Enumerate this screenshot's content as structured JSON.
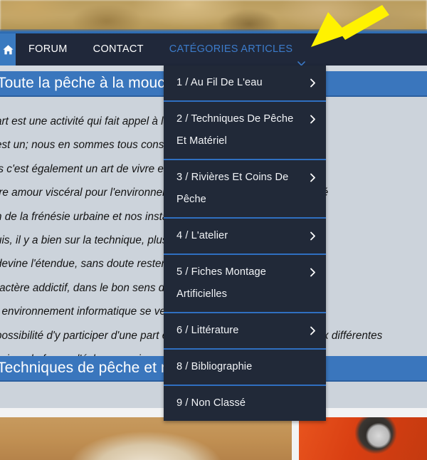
{
  "site": {
    "hero_alt": "blurred golden field photo banner"
  },
  "navbar": {
    "home_icon": "home-icon",
    "items": [
      {
        "label": "FORUM",
        "accent": false
      },
      {
        "label": "CONTACT",
        "accent": false
      },
      {
        "label": "CATÉGORIES ARTICLES",
        "accent": true,
        "icon": "chevron-down-icon"
      }
    ]
  },
  "annotation": {
    "type": "arrow",
    "color": "#FFF200",
    "points_to": "CATÉGORIES ARTICLES"
  },
  "dropdown": {
    "open": true,
    "parent": "CATÉGORIES ARTICLES",
    "items": [
      {
        "label": "1 / Au Fil De L'eau",
        "has_submenu": true
      },
      {
        "label": "2 / Techniques De Pêche Et Matériel",
        "has_submenu": true
      },
      {
        "label": "3 / Rivières Et Coins De Pêche",
        "has_submenu": true
      },
      {
        "label": "4 / L'atelier",
        "has_submenu": true
      },
      {
        "label": "5 / Fiches Montage Artificielles",
        "has_submenu": true
      },
      {
        "label": "6 / Littérature",
        "has_submenu": true
      },
      {
        "label": "8 / Bibliographie",
        "has_submenu": false
      },
      {
        "label": "9 / Non Classé",
        "has_submenu": false
      }
    ]
  },
  "content": {
    "heading_1": "Toute la pêche à la mouche",
    "heading_2": "Techniques de pêche et matériel",
    "paragraph_lines": [
      "art est une activité qui fait appel à la créativité et à l'imagination",
      "est un; nous en sommes tous conscients",
      "is c'est également un art de vivre et de cultiver des valeurs qui",
      "tre amour viscéral pour l'environnement, de partage et de convivialité",
      "n de la frénésie urbaine et nos instants contemplatifs, au rythme",
      "uis, il y a bien sur la technique, plus on pratique plus on apprend",
      "devine l'étendue, sans doute restera-t-il encore inconnu, et c'est",
      "ractère addictif, dans le bon sens du terme",
      "t environnement informatique se veut le reflet de ces différentes",
      "possibilité d'y participer d'une part en apportant vos contributions aux différentes",
      "ssi par le forum d'échange qui vous est ouvert"
    ]
  },
  "thumbnails": [
    {
      "name": "thumbnail-fly-tying-material"
    },
    {
      "name": "thumbnail-abrasive-disc"
    }
  ],
  "colors": {
    "nav_background": "#20283a",
    "accent_blue": "#3c7ccb",
    "banner_blue": "#3a76bd",
    "page_background": "#ccd3db",
    "dropdown_background": "#212938",
    "divider_blue": "#2f6fc0",
    "arrow_yellow": "#FFF200"
  }
}
